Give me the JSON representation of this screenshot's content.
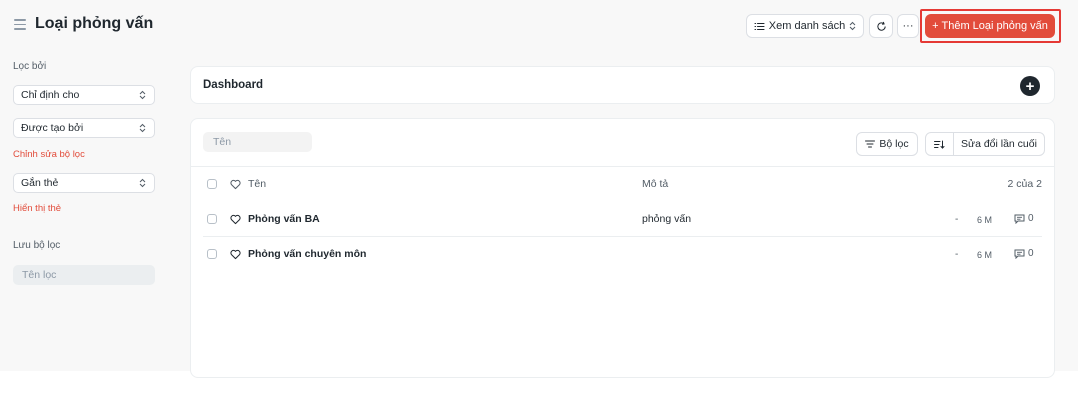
{
  "header": {
    "title": "Loại phỏng vấn",
    "view_button": "Xem danh sách",
    "more_button": "···",
    "add_button": "Thêm Loại phỏng vấn"
  },
  "sidebar": {
    "filter_by": "Lọc bởi",
    "assigned_to": "Chỉ định cho",
    "created_by": "Được tạo bởi",
    "edit_filters": "Chỉnh sửa bộ lọc",
    "tags": "Gắn thẻ",
    "show_tags": "Hiển thị thẻ",
    "save_filter": "Lưu bộ lọc",
    "filter_name_placeholder": "Tên lọc"
  },
  "dashboard": {
    "title": "Dashboard"
  },
  "list": {
    "search_placeholder": "Tên",
    "filter_button": "Bộ lọc",
    "sort_button": "Sửa đổi lần cuối",
    "columns": {
      "name": "Tên",
      "description": "Mô tả",
      "count": "2 của 2"
    },
    "rows": [
      {
        "name": "Phỏng vấn BA",
        "description": "phỏng vấn",
        "dash": "-",
        "modified": "6 M",
        "comments": "0"
      },
      {
        "name": "Phỏng vấn chuyên môn",
        "description": "",
        "dash": "-",
        "modified": "6 M",
        "comments": "0"
      }
    ]
  },
  "colors": {
    "primary": "#e24c3b",
    "highlight": "#e53935",
    "text": "#1f272e"
  }
}
